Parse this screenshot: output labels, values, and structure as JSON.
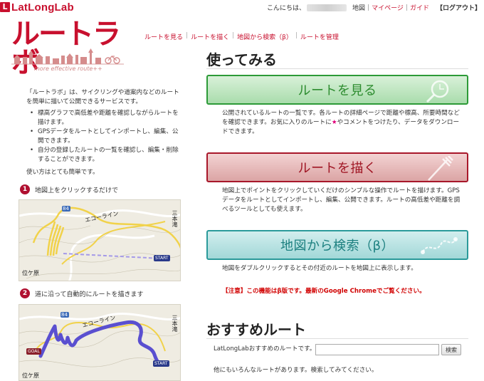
{
  "header": {
    "logo_mark": "L",
    "logo_text": "LatLongLab",
    "greeting": "こんにちは、",
    "links": [
      "地図",
      "マイページ",
      "ガイド"
    ],
    "logout": "【ログアウト】"
  },
  "brand": {
    "title": "ルートラボ",
    "tagline": "more effective route++"
  },
  "subnav": [
    "ルートを見る",
    "ルートを描く",
    "地図から検索（β）",
    "ルートを管理"
  ],
  "intro": {
    "text": "「ルートラボ」は、サイクリングや道案内などのルートを簡単に描いて公開できるサービスです。",
    "bullets": [
      "標高グラフで高低差や距離を確認しながらルートを描けます。",
      "GPSデータをルートとしてインポートし、編集、公開できます。",
      "自分の登録したルートの一覧を確認し、編集・削除することができます。"
    ],
    "howto": "使い方はとても簡単です。"
  },
  "steps": [
    {
      "num": "1",
      "label": "地図上をクリックするだけで"
    },
    {
      "num": "2",
      "label": "道に沿って自動的にルートを描きます"
    }
  ],
  "maps": {
    "route_number": "84",
    "eco_line": "エコーライン",
    "place_right": "三本滝",
    "place_left": "位ケ原",
    "start": "START",
    "goal": "GOAL"
  },
  "main": {
    "try_heading": "使ってみる",
    "actions": [
      {
        "label": "ルートを見る",
        "desc": "公開されているルートの一覧です。各ルートの詳細ページで距離や標高、所要時間などを確認できます。お気に入りのルートに"
      },
      {
        "label": "ルートを描く",
        "desc": "地図上でポイントをクリックしていくだけのシンプルな操作でルートを描けます。GPSデータをルートとしてインポートし、編集、公開できます。ルートの高低差や距離を調べるツールとしても使えます。"
      },
      {
        "label": "地図から検索（β）",
        "desc": "地図をダブルクリックするとその付近のルートを地図上に表示します。"
      }
    ],
    "star": "★",
    "fav_suffix": "やコメントをつけたり、データをダウンロードできます。",
    "warning": "【注意】この機能はβ版です。最新のGoogle Chromeでご覧ください。",
    "recommended_heading": "おすすめルート",
    "rec_label": "LatLongLabおすすめのルートです。",
    "rec_input_value": "",
    "rec_button": "検索",
    "rec_more": "他にもいろんなルートがあります。検索してみてください。"
  },
  "colors": {
    "brand_red": "#c8102e",
    "view_green": "#2c9a37",
    "draw_red": "#a8172a",
    "search_teal": "#2a9a9a",
    "warning_red": "#d10000",
    "route_blue": "#5a4fd0",
    "route_yellow": "#f1d24a"
  }
}
